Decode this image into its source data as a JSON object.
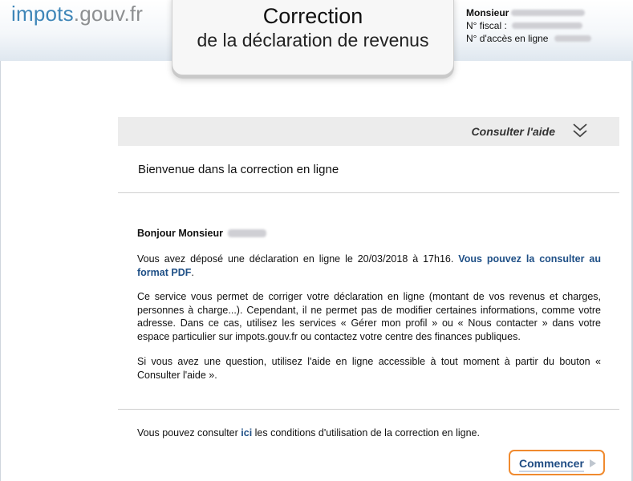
{
  "header": {
    "logo_part1": "impots",
    "logo_part2": ".gouv.fr",
    "title_line1": "Correction",
    "title_line2": "de la déclaration de revenus"
  },
  "taxpayer": {
    "name_label": "Monsieur",
    "fiscal_label": "N° fiscal :",
    "access_label": "N° d'accès en ligne"
  },
  "help": {
    "label": "Consulter l'aide",
    "icon": "double-chevron-down-icon"
  },
  "welcome": {
    "title": "Bienvenue dans la correction en ligne"
  },
  "message": {
    "greeting": "Bonjour Monsieur",
    "deposit_text": "Vous avez déposé une déclaration en ligne le 20/03/2018 à 17h16.",
    "deposit_link": "Vous pouvez la consulter au format PDF",
    "deposit_end": ".",
    "service_text": "Ce service vous permet de corriger votre déclaration en ligne (montant de vos revenus et charges, personnes à charge...). Cependant, il ne permet pas de modifier certaines informations, comme votre adresse. Dans ce cas, utilisez les services « Gérer mon profil » ou « Nous contacter » dans votre espace particulier sur impots.gouv.fr ou contactez votre centre des finances publiques.",
    "question_text": "Si vous avez une question, utilisez l'aide en ligne accessible à tout moment à partir du bouton « Consulter l'aide »."
  },
  "terms": {
    "prefix": "Vous pouvez consulter",
    "link": "ici",
    "suffix": "les conditions d'utilisation de la correction en ligne."
  },
  "actions": {
    "start_label": "Commencer"
  },
  "colors": {
    "brand_blue": "#3f86b8",
    "link_blue": "#1e4f86",
    "accent_orange": "#f08a2e"
  }
}
